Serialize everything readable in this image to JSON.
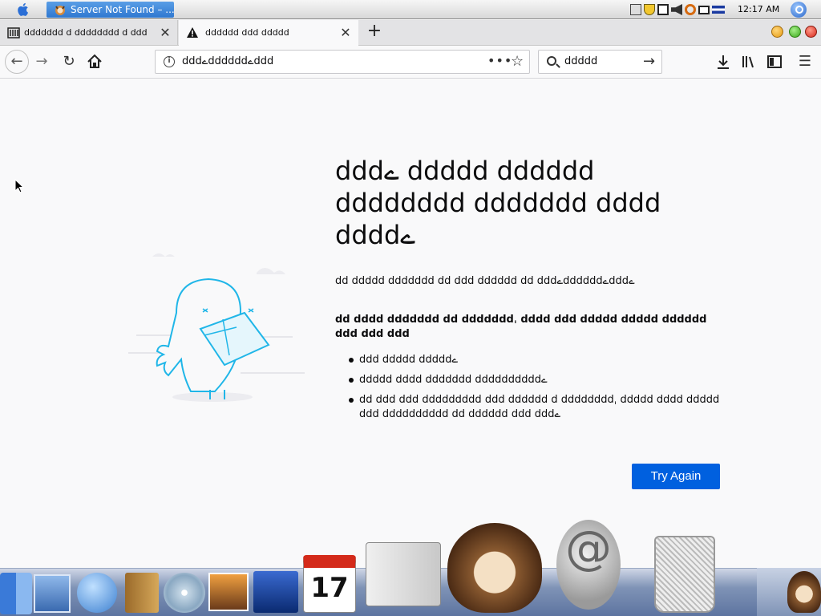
{
  "menubar": {
    "task_title": "Server Not Found – ...",
    "clock": "12:17 AM"
  },
  "tabs": [
    {
      "label": "ddddddd d dddddddd d ddd"
    },
    {
      "label": "dddddd ddd ddddd"
    }
  ],
  "navbar": {
    "url": "dddےddddddےddd",
    "search_value": "ddddd"
  },
  "error": {
    "title": "dddے ddddd dddddd dddddddd ddddddd dddd ddddے",
    "description": "dd ddddd ddddddd dd ddd dddddd dd dddےddddddےdddے",
    "bold_text": "dd dddd ddddddd dd dddddddˌ dddd ddd ddddd ddddd dddddd ddd ddd ddd",
    "suggestions": [
      "ddd ddddd dddddے",
      "ddddd dddd ddddddd ddddddddddے",
      "dd ddd ddd ddddddddd ddd dddddd d ddddddddˌ ddddd dddd ddddd ddd dddddddddd dd dddddd ddd dddے"
    ],
    "try_again_label": "Try Again"
  },
  "colors": {
    "primary_button": "#0060df",
    "page_background": "#f9f9fa"
  }
}
